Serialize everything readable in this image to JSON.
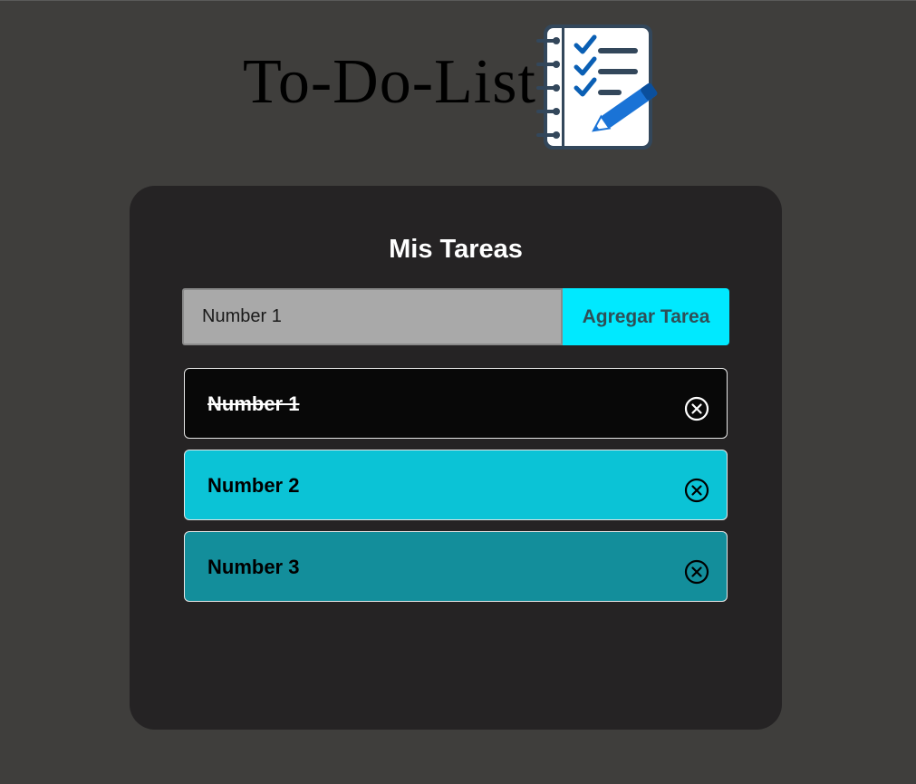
{
  "header": {
    "title": "To-Do-List",
    "logo_icon": "notebook-checklist-pencil-icon"
  },
  "card": {
    "title": "Mis Tareas",
    "input": {
      "value": "Number 1",
      "placeholder": ""
    },
    "add_button_label": "Agregar Tarea"
  },
  "tasks": [
    {
      "label": "Number 1",
      "completed": true,
      "background": "#080808",
      "text_color": "#ffffff",
      "icon_color": "#ffffff",
      "delete_icon": "circle-x-icon"
    },
    {
      "label": "Number 2",
      "completed": false,
      "background": "#0bc3d6",
      "text_color": "#000000",
      "icon_color": "#000000",
      "delete_icon": "circle-x-icon"
    },
    {
      "label": "Number 3",
      "completed": false,
      "background": "#138e9b",
      "text_color": "#000000",
      "icon_color": "#000000",
      "delete_icon": "circle-x-icon"
    }
  ],
  "colors": {
    "page_background": "#3f3e3c",
    "card_background": "#252324",
    "input_background": "#a9a9a9",
    "accent": "#00e9ff",
    "button_text": "#2f4f56"
  }
}
